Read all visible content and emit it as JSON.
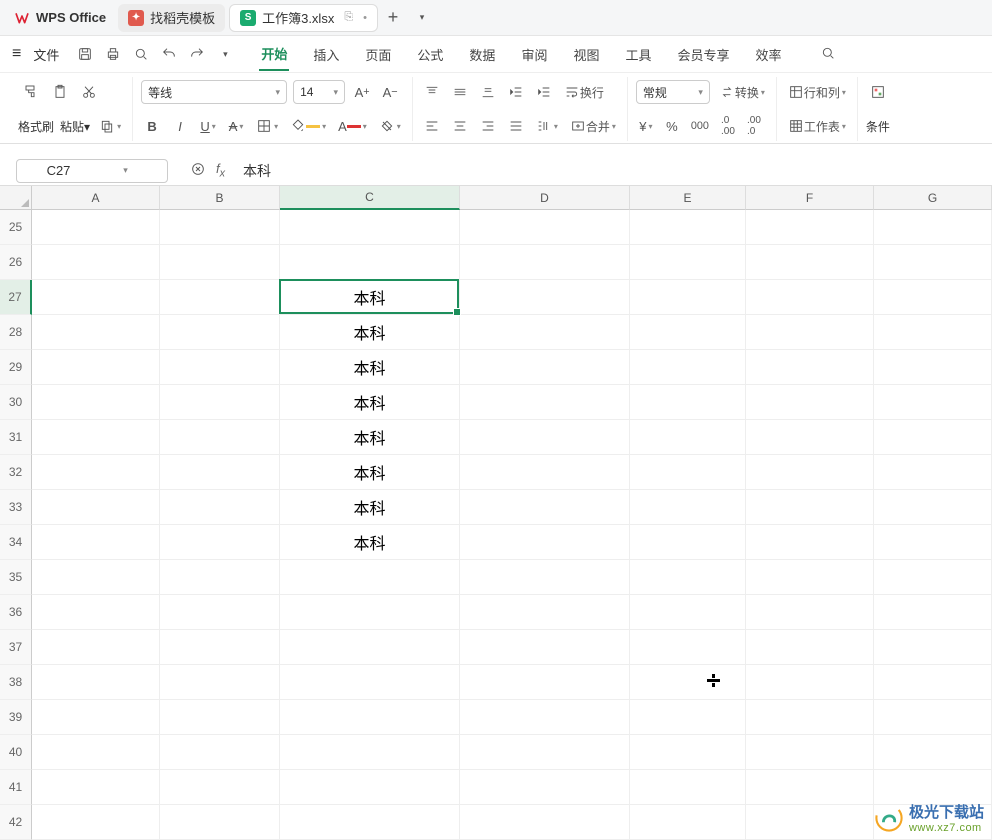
{
  "app": {
    "name": "WPS Office"
  },
  "tabs": [
    {
      "label": "找稻壳模板"
    },
    {
      "label": "工作簿3.xlsx"
    }
  ],
  "qat": {
    "file": "文件"
  },
  "menu": {
    "items": [
      "开始",
      "插入",
      "页面",
      "公式",
      "数据",
      "审阅",
      "视图",
      "工具",
      "会员专享",
      "效率"
    ],
    "active": 0
  },
  "ribbon": {
    "format_painter": "格式刷",
    "paste": "粘贴",
    "font_name": "等线",
    "font_size": "14",
    "wrap": "换行",
    "merge": "合并",
    "number_format": "常规",
    "convert": "转换",
    "row_col": "行和列",
    "worksheet": "工作表",
    "conditional": "条件"
  },
  "namebox": "C27",
  "formula_value": "本科",
  "grid": {
    "col_widths": {
      "A": 128,
      "B": 120,
      "C": 180,
      "D": 170,
      "E": 116,
      "F": 128,
      "G": 118
    },
    "columns": [
      "A",
      "B",
      "C",
      "D",
      "E",
      "F",
      "G"
    ],
    "active_col": "C",
    "row_start": 25,
    "row_end": 42,
    "active_row": 27,
    "data": {
      "C27": "本科",
      "C28": "本科",
      "C29": "本科",
      "C30": "本科",
      "C31": "本科",
      "C32": "本科",
      "C33": "本科",
      "C34": "本科"
    }
  },
  "watermark": {
    "line1": "极光下载站",
    "line2": "www.xz7.com"
  }
}
